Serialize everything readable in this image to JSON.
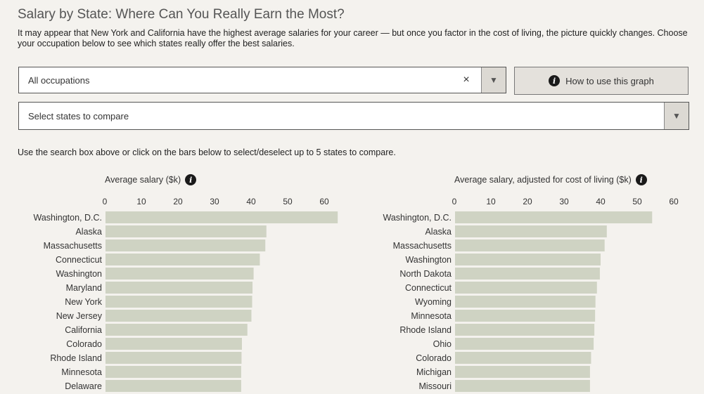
{
  "header": {
    "title": "Salary by State: Where Can You Really Earn the Most?",
    "subtitle": "It may appear that New York and California have the highest average salaries for your career — but once you factor in the cost of living, the picture quickly changes. Choose your occupation below to see which states really offer the best salaries."
  },
  "controls": {
    "occupation_value": "All occupations",
    "clear_symbol": "×",
    "dropdown_arrow": "▼",
    "states_placeholder": "Select states to compare",
    "help_label": "How to use this graph",
    "info_symbol": "i"
  },
  "instruction": "Use the search box above or click on the bars below to select/deselect up to 5 states to compare.",
  "colors": {
    "bar": "#cfd3c3",
    "background": "#f4f2ee"
  },
  "chart_data": [
    {
      "type": "bar",
      "orientation": "horizontal",
      "title": "Average salary ($k)",
      "xlim": [
        0,
        60
      ],
      "ticks": [
        0,
        10,
        20,
        30,
        40,
        50,
        60
      ],
      "categories": [
        "Washington, D.C.",
        "Alaska",
        "Massachusetts",
        "Connecticut",
        "Washington",
        "Maryland",
        "New York",
        "New Jersey",
        "California",
        "Colorado",
        "Rhode Island",
        "Minnesota",
        "Delaware"
      ],
      "values": [
        63.5,
        44,
        43.7,
        42.2,
        40.5,
        40.2,
        40.1,
        39.9,
        38.8,
        37.3,
        37.2,
        37.1,
        37.1
      ]
    },
    {
      "type": "bar",
      "orientation": "horizontal",
      "title": "Average salary, adjusted for cost of living ($k)",
      "xlim": [
        0,
        60
      ],
      "ticks": [
        0,
        10,
        20,
        30,
        40,
        50,
        60
      ],
      "categories": [
        "Washington, D.C.",
        "Alaska",
        "Massachusetts",
        "Washington",
        "North Dakota",
        "Connecticut",
        "Wyoming",
        "Minnesota",
        "Rhode Island",
        "Ohio",
        "Colorado",
        "Michigan",
        "Missouri"
      ],
      "values": [
        53.9,
        41.5,
        40.9,
        39.8,
        39.6,
        38.8,
        38.4,
        38.3,
        38.1,
        37.9,
        37.2,
        36.9,
        36.9
      ]
    }
  ]
}
